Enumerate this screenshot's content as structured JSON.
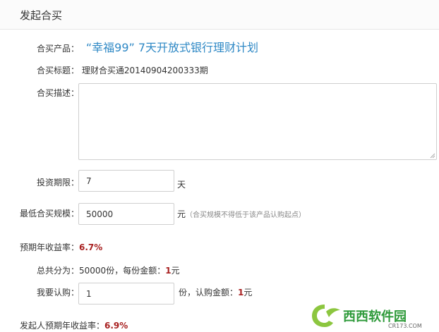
{
  "header": {
    "title": "发起合买"
  },
  "product": {
    "label": "合买产品：",
    "name": "“幸福99” 7天开放式银行理财计划"
  },
  "title_row": {
    "label": "合买标题：",
    "value": "理财合买通20140904200333期"
  },
  "description": {
    "label": "合买描述：",
    "value": ""
  },
  "period": {
    "label": "投资期限：",
    "value": "7",
    "unit": "天"
  },
  "min_scale": {
    "label": "最低合买规模：",
    "value": "50000",
    "unit": "元",
    "hint": "（合买规模不得低于该产品认购起点）"
  },
  "expected_rate": {
    "label": "预期年收益率：",
    "value": "6.7%"
  },
  "shares": {
    "label": "总共分为：",
    "count_text": "50000份，每份金额：",
    "per_share": "1",
    "unit": "元"
  },
  "subscribe": {
    "label": "我要认购：",
    "value": "1",
    "suffix": "份，认购金额：",
    "amount": "1",
    "unit": "元"
  },
  "initiator_rate": {
    "label": "发起人预期年收益率：",
    "value": "6.9%"
  },
  "watermark": {
    "brand": "西西软件园",
    "domain": "CR173.COM"
  }
}
